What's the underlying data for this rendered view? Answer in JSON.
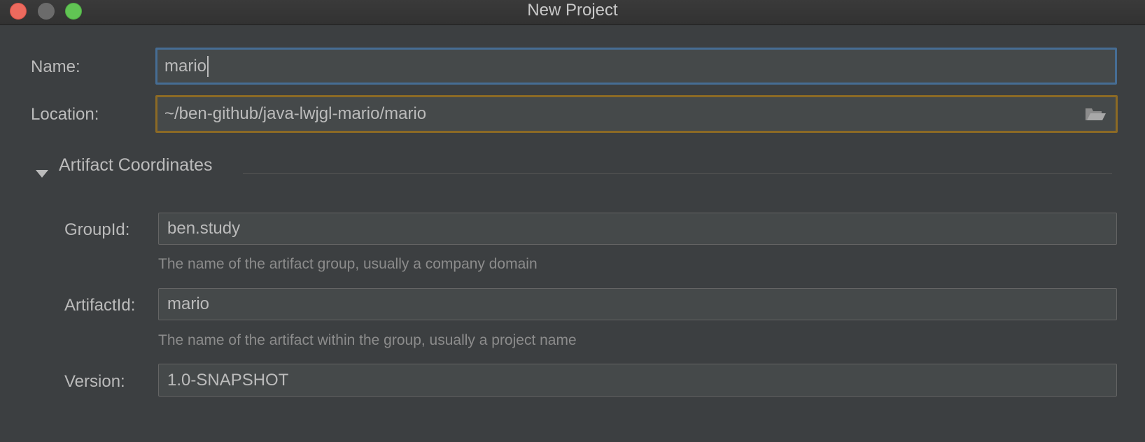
{
  "window": {
    "title": "New Project"
  },
  "project": {
    "name_label": "Name:",
    "name_value": "mario",
    "location_label": "Location:",
    "location_value": "~/ben-github/java-lwjgl-mario/mario"
  },
  "artifact": {
    "section_title": "Artifact Coordinates",
    "group_label": "GroupId:",
    "group_value": "ben.study",
    "group_hint": "The name of the artifact group, usually a company domain",
    "artifact_label": "ArtifactId:",
    "artifact_value": "mario",
    "artifact_hint": "The name of the artifact within the group, usually a project name",
    "version_label": "Version:",
    "version_value": "1.0-SNAPSHOT"
  },
  "colors": {
    "focus": "#466d94",
    "warning": "#8c6a25",
    "background": "#3c3f41"
  },
  "icons": {
    "browse": "folder-open-icon",
    "collapse": "triangle-down-icon"
  }
}
